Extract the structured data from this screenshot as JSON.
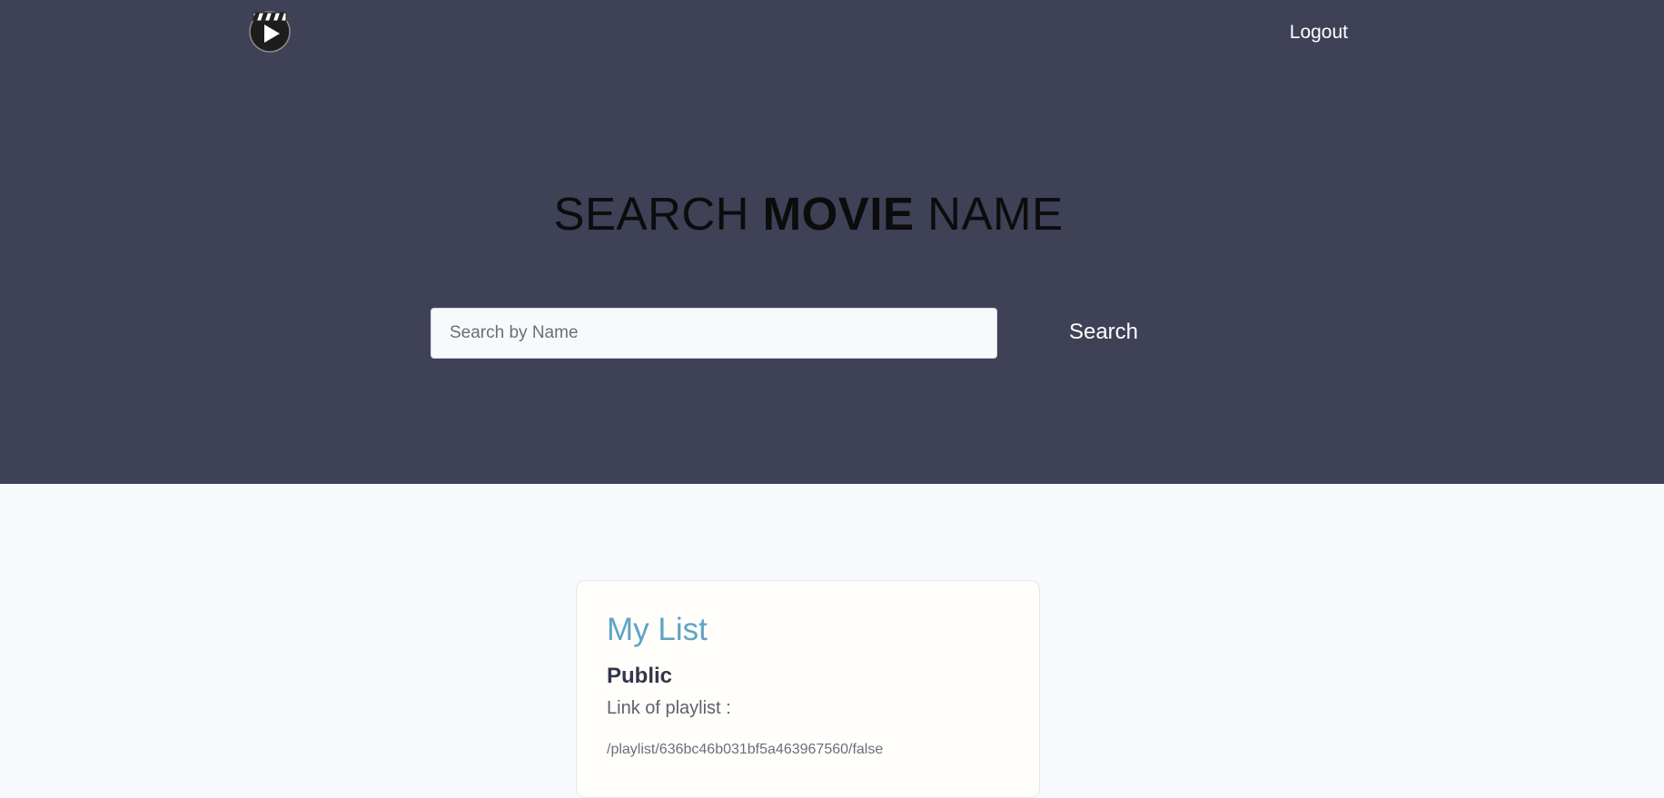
{
  "header": {
    "logo_icon": "movie-clapperboard-play-icon",
    "logout_label": "Logout"
  },
  "hero": {
    "headline_part1": "SEARCH ",
    "headline_emphasis": "MOVIE",
    "headline_part2": " NAME",
    "search_placeholder": "Search by Name",
    "search_value": "",
    "search_button_label": "Search"
  },
  "playlist_card": {
    "title": "My List",
    "visibility": "Public",
    "link_label": "Link of playlist :",
    "link_url": "/playlist/636bc46b031bf5a463967560/false"
  },
  "colors": {
    "hero_background": "#3f4157",
    "page_background": "#f8f9fd",
    "card_title": "#5ea3c6",
    "card_visibility": "#33364a"
  }
}
